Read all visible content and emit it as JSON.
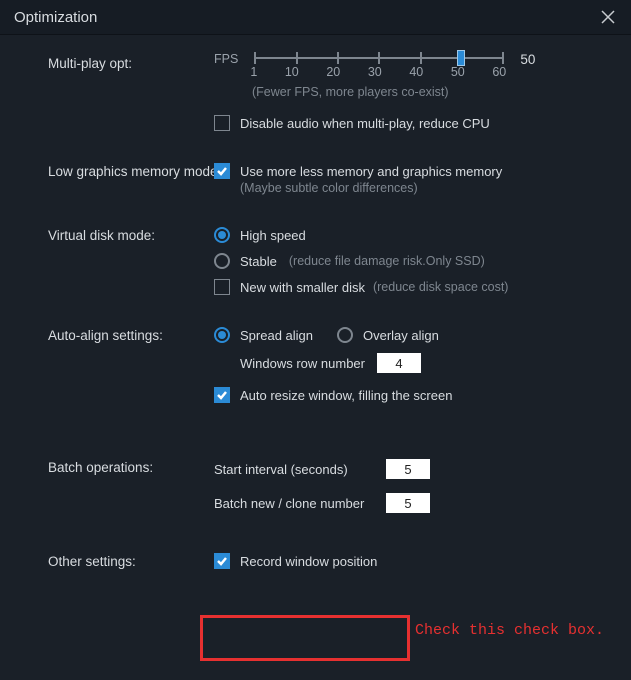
{
  "title": "Optimization",
  "sections": {
    "multiplay": {
      "label": "Multi-play opt:",
      "fps_label": "FPS",
      "ticks": [
        "1",
        "10",
        "20",
        "30",
        "40",
        "50",
        "60"
      ],
      "value": "50",
      "hint": "(Fewer FPS, more players co-exist)",
      "disable_audio": {
        "checked": false,
        "label": "Disable audio when multi-play, reduce CPU"
      }
    },
    "lowmem": {
      "label": "Low graphics memory mode:",
      "use_less": {
        "checked": true,
        "label": "Use more less memory and graphics memory",
        "hint": "(Maybe subtle color differences)"
      }
    },
    "vdisk": {
      "label": "Virtual disk mode:",
      "high_speed": {
        "checked": true,
        "label": "High speed"
      },
      "stable": {
        "checked": false,
        "label": "Stable",
        "hint": "(reduce file damage risk.Only SSD)"
      },
      "new_smaller": {
        "checked": false,
        "label": "New with smaller disk",
        "hint": "(reduce disk space cost)"
      }
    },
    "autoalign": {
      "label": "Auto-align settings:",
      "spread": {
        "checked": true,
        "label": "Spread align"
      },
      "overlay": {
        "checked": false,
        "label": "Overlay align"
      },
      "rownum_label": "Windows row number",
      "rownum_value": "4",
      "auto_resize": {
        "checked": true,
        "label": "Auto resize window, filling the screen"
      }
    },
    "batch": {
      "label": "Batch operations:",
      "start_interval_label": "Start interval (seconds)",
      "start_interval_value": "5",
      "clone_label": "Batch new / clone number",
      "clone_value": "5"
    },
    "other": {
      "label": "Other settings:",
      "record_pos": {
        "checked": true,
        "label": "Record window position"
      }
    }
  },
  "annotation": {
    "text": "Check this check box."
  }
}
